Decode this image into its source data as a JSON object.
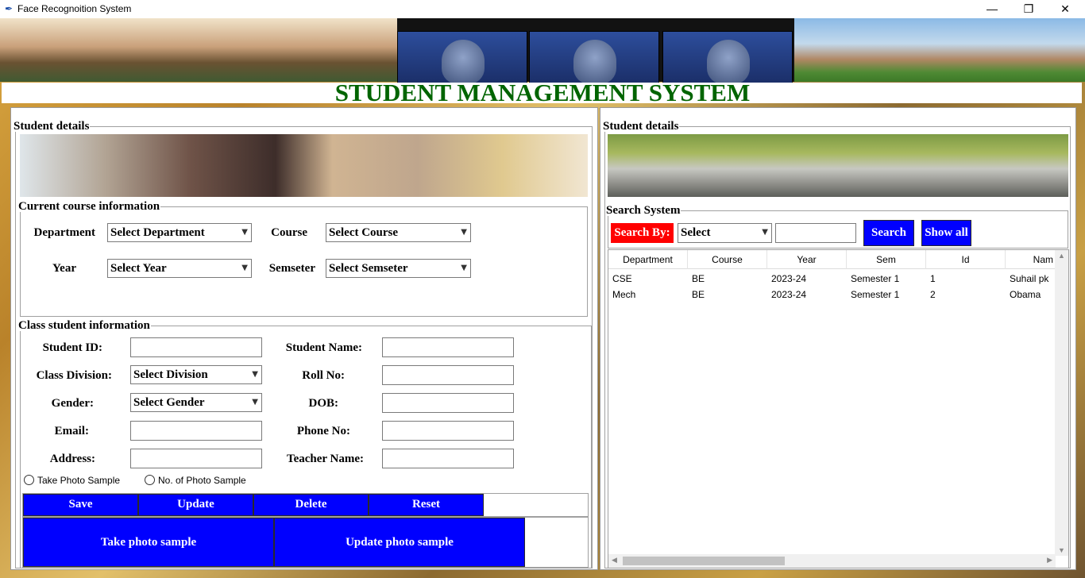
{
  "window": {
    "title": "Face Recognoition System",
    "minimize": "—",
    "maximize": "❐",
    "close": "✕"
  },
  "page_title": "STUDENT MANAGEMENT SYSTEM",
  "left": {
    "frame_title": "Student details",
    "course": {
      "title": "Current course information",
      "department_label": "Department",
      "department_value": "Select Department",
      "course_label": "Course",
      "course_value": "Select Course",
      "year_label": "Year",
      "year_value": "Select Year",
      "semester_label": "Semseter",
      "semester_value": "Select Semseter"
    },
    "student": {
      "title": "Class student information",
      "student_id_label": "Student ID:",
      "student_name_label": "Student Name:",
      "class_division_label": "Class Division:",
      "class_division_value": "Select Division",
      "roll_no_label": "Roll No:",
      "gender_label": "Gender:",
      "gender_value": "Select Gender",
      "dob_label": "DOB:",
      "email_label": "Email:",
      "phone_label": "Phone No:",
      "address_label": "Address:",
      "teacher_label": "Teacher Name:",
      "radio1": "Take Photo Sample",
      "radio2": "No. of Photo Sample"
    },
    "buttons": {
      "save": "Save",
      "update": "Update",
      "delete": "Delete",
      "reset": "Reset",
      "take_photo": "Take photo sample",
      "update_photo": "Update photo sample"
    }
  },
  "right": {
    "frame_title": "Student details",
    "search": {
      "title": "Search System",
      "by_label": "Search By:",
      "by_value": "Select",
      "search_button": "Search",
      "show_all_button": "Show all"
    },
    "table": {
      "columns": [
        "Department",
        "Course",
        "Year",
        "Sem",
        "Id",
        "Nam"
      ],
      "rows": [
        [
          "CSE",
          "BE",
          "2023-24",
          "Semester 1",
          "1",
          "Suhail pk"
        ],
        [
          "Mech",
          "BE",
          "2023-24",
          "Semester 1",
          "2",
          "Obama"
        ]
      ]
    }
  },
  "colors": {
    "title_green": "#006400",
    "button_blue": "#0000ff",
    "search_red": "#ff0000"
  },
  "icons": [
    "feather-icon",
    "chevron-down-icon",
    "minimize-icon",
    "maximize-icon",
    "close-icon"
  ]
}
